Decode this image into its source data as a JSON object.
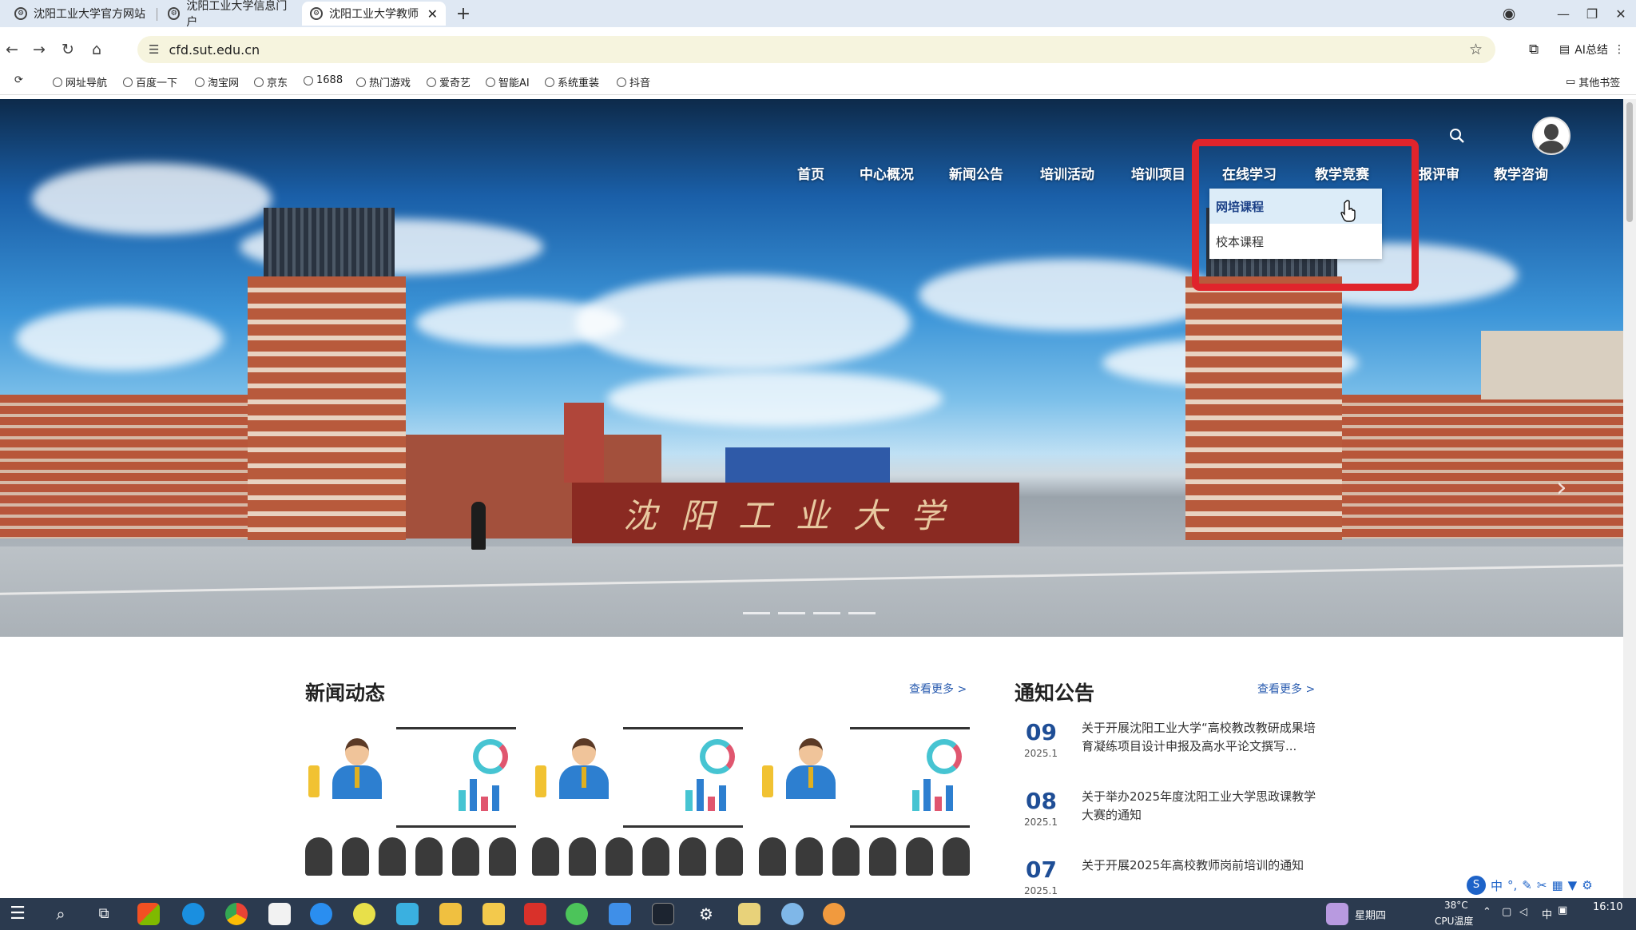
{
  "browser": {
    "tabs": [
      {
        "title": "沈阳工业大学官方网站",
        "active": false
      },
      {
        "title": "沈阳工业大学信息门户",
        "active": false
      },
      {
        "title": "沈阳工业大学教师",
        "active": true
      }
    ],
    "address": "cfd.sut.edu.cn",
    "ai_label": "AI总结",
    "bookmarks": [
      "网址导航",
      "百度一下",
      "淘宝网",
      "京东",
      "1688",
      "热门游戏",
      "爱奇艺",
      "智能AI",
      "系统重装",
      "抖音"
    ],
    "other_bookmarks": "其他书签"
  },
  "site": {
    "gate_text": "沈阳工业大学",
    "nav": [
      "首页",
      "中心概况",
      "新闻公告",
      "培训活动",
      "培训项目",
      "在线学习",
      "教学竞赛",
      "报评审",
      "教学咨询"
    ],
    "dropdown": [
      "网培课程",
      "校本课程"
    ],
    "news": {
      "title": "新闻动态",
      "more": "查看更多 >"
    },
    "notices": {
      "title": "通知公告",
      "more": "查看更多 >",
      "items": [
        {
          "day": "09",
          "ym": "2025.1",
          "text": "关于开展沈阳工业大学“高校教改教研成果培育凝练项目设计申报及高水平论文撰写..."
        },
        {
          "day": "08",
          "ym": "2025.1",
          "text": "关于举办2025年度沈阳工业大学思政课教学大赛的通知"
        },
        {
          "day": "07",
          "ym": "2025.1",
          "text": "关于开展2025年高校教师岗前培训的通知"
        }
      ]
    }
  },
  "system": {
    "ime": "中",
    "weekday": "星期四",
    "temp": "38°C",
    "cpu": "CPU温度",
    "lang": "中",
    "time": "16:10"
  },
  "colors": {
    "highlight": "#e0242c",
    "link": "#2b5db0",
    "date": "#1f4e96"
  }
}
